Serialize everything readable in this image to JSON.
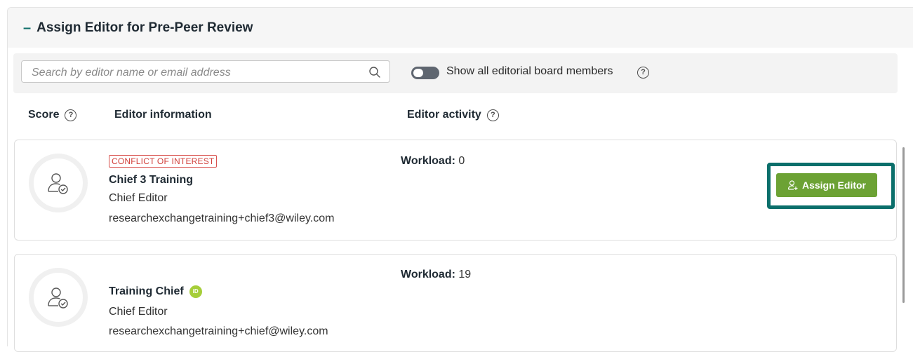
{
  "section": {
    "collapse_symbol": "–",
    "title": "Assign Editor for Pre-Peer Review"
  },
  "search": {
    "placeholder": "Search by editor name or email address",
    "value": ""
  },
  "toggle": {
    "label": "Show all editorial board members",
    "state": "off"
  },
  "columns": {
    "score": "Score",
    "editor_info": "Editor information",
    "editor_activity": "Editor activity"
  },
  "help_glyph": "?",
  "editors": [
    {
      "badge": "CONFLICT OF INTEREST",
      "name": "Chief 3 Training",
      "role": "Chief Editor",
      "email": "researchexchangetraining+chief3@wiley.com",
      "workload_label": "Workload:",
      "workload_value": "0",
      "action_label": "Assign Editor"
    },
    {
      "name": "Training Chief",
      "orcid_label": "iD",
      "role": "Chief Editor",
      "email": "researchexchangetraining+chief@wiley.com",
      "workload_label": "Workload:",
      "workload_value": "19"
    }
  ],
  "colors": {
    "accent_teal": "#0b6f6b",
    "button_green": "#6ca234",
    "conflict_red": "#d13f3a",
    "orcid_green": "#a6ce39"
  },
  "icons": [
    "search-icon",
    "help-icon",
    "user-check-icon",
    "user-plus-icon",
    "orcid-icon"
  ]
}
